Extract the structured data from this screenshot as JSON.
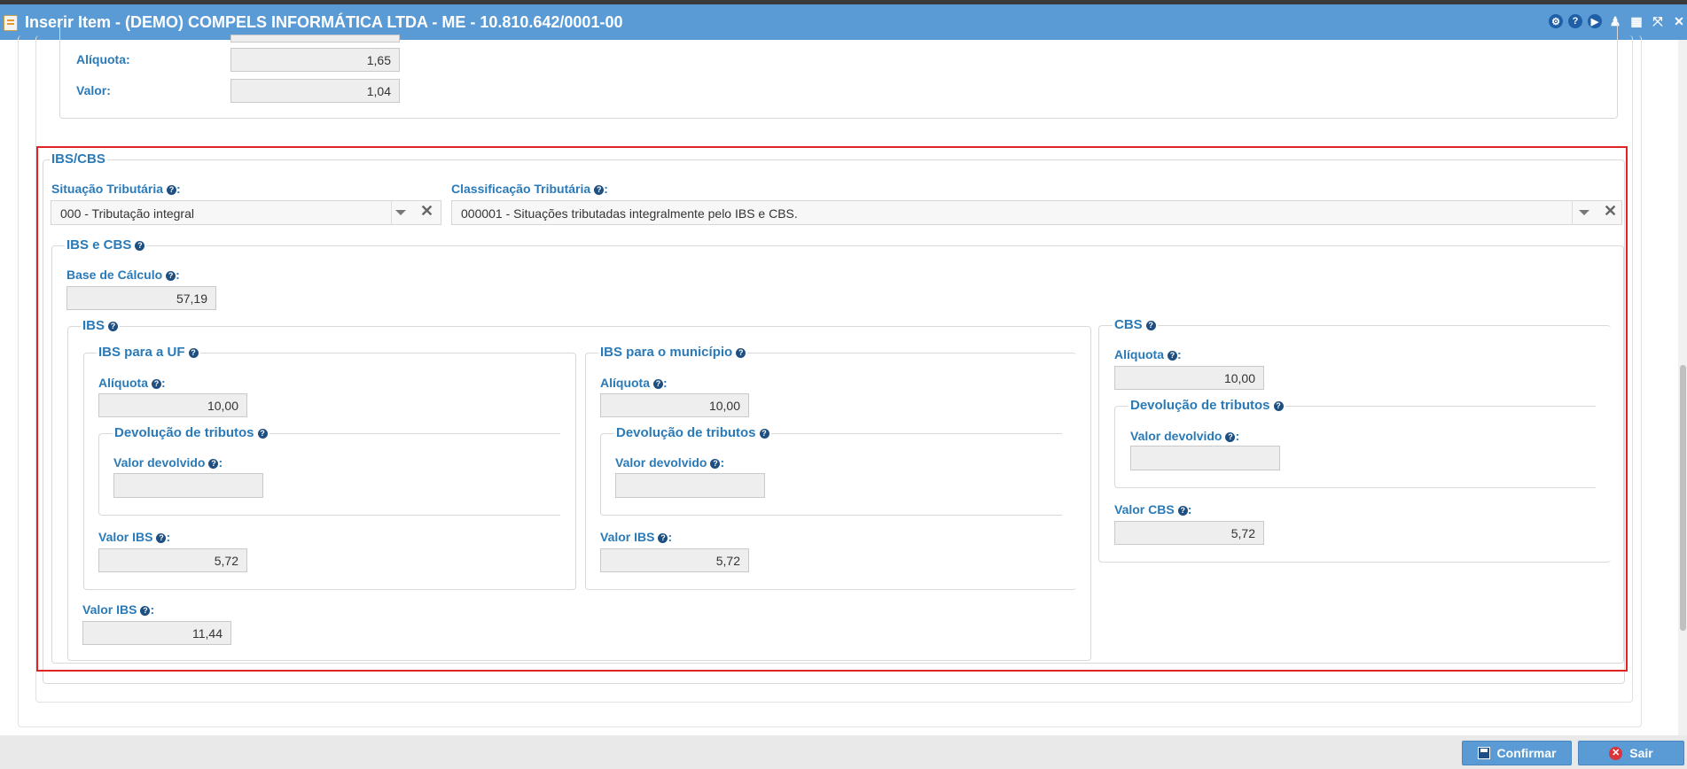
{
  "window": {
    "title": "Inserir Item - (DEMO) COMPELS INFORMÁTICA LTDA - ME - 10.810.642/0001-00",
    "title_icons": [
      "settings-icon",
      "help-icon",
      "play-icon",
      "user-icon",
      "calendar-icon",
      "expand-icon",
      "close-icon"
    ]
  },
  "top_section": {
    "aliquota_label": "Alíquota:",
    "aliquota_value": "1,65",
    "valor_label": "Valor:",
    "valor_value": "1,04"
  },
  "ibs_cbs": {
    "legend": "IBS/CBS",
    "situacao_label": "Situação Tributária",
    "situacao_value": "000 - Tributação integral",
    "classificacao_label": "Classificação Tributária",
    "classificacao_value": "000001 - Situações tributadas integralmente pelo IBS e CBS.",
    "colon": ":",
    "group": {
      "legend": "IBS e CBS",
      "base_calculo_label": "Base de Cálculo",
      "base_calculo_value": "57,19",
      "ibs": {
        "legend": "IBS",
        "uf": {
          "legend": "IBS para a UF",
          "aliquota_label": "Alíquota",
          "aliquota_value": "10,00",
          "devolucao_legend": "Devolução de tributos",
          "valor_devolvido_label": "Valor devolvido",
          "valor_devolvido_value": "",
          "valor_ibs_label": "Valor IBS",
          "valor_ibs_value": "5,72"
        },
        "municipio": {
          "legend": "IBS para o município",
          "aliquota_label": "Alíquota",
          "aliquota_value": "10,00",
          "devolucao_legend": "Devolução de tributos",
          "valor_devolvido_label": "Valor devolvido",
          "valor_devolvido_value": "",
          "valor_ibs_label": "Valor IBS",
          "valor_ibs_value": "5,72"
        },
        "valor_ibs_total_label": "Valor IBS",
        "valor_ibs_total_value": "11,44"
      },
      "cbs": {
        "legend": "CBS",
        "aliquota_label": "Alíquota",
        "aliquota_value": "10,00",
        "devolucao_legend": "Devolução de tributos",
        "valor_devolvido_label": "Valor devolvido",
        "valor_devolvido_value": "",
        "valor_cbs_label": "Valor CBS",
        "valor_cbs_value": "5,72"
      }
    }
  },
  "footer": {
    "confirm_label": "Confirmar",
    "exit_label": "Sair"
  },
  "colors": {
    "titlebar": "#5b9bd5",
    "label_blue": "#2a7ab8",
    "highlight_border": "#e02424"
  }
}
